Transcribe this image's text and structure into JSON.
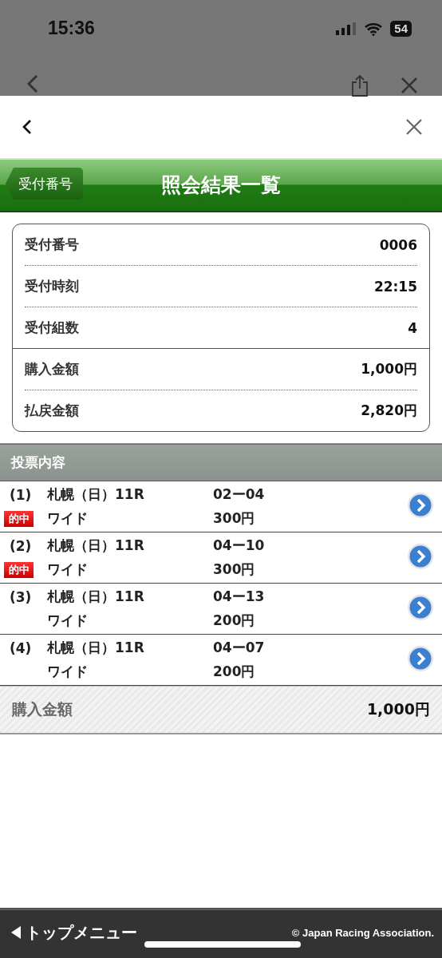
{
  "status_bar": {
    "time": "15:36",
    "battery": "54"
  },
  "header": {
    "back_label": "受付番号",
    "title": "照会結果一覧"
  },
  "summary": {
    "groups": [
      {
        "rows": [
          {
            "label": "受付番号",
            "value": "0006"
          },
          {
            "label": "受付時刻",
            "value": "22:15"
          },
          {
            "label": "受付組数",
            "value": "4"
          }
        ]
      },
      {
        "rows": [
          {
            "label": "購入金額",
            "value": "1,000円"
          },
          {
            "label": "払戻金額",
            "value": "2,820円"
          }
        ]
      }
    ]
  },
  "bets": {
    "section_title": "投票内容",
    "items": [
      {
        "number": "(1)",
        "venue": "札幌（日）11R",
        "hit": true,
        "hit_label": "的中",
        "type": "ワイド",
        "combination": "02ー04",
        "amount": "300円"
      },
      {
        "number": "(2)",
        "venue": "札幌（日）11R",
        "hit": true,
        "hit_label": "的中",
        "type": "ワイド",
        "combination": "04ー10",
        "amount": "300円"
      },
      {
        "number": "(3)",
        "venue": "札幌（日）11R",
        "hit": false,
        "type": "ワイド",
        "combination": "04ー13",
        "amount": "200円"
      },
      {
        "number": "(4)",
        "venue": "札幌（日）11R",
        "hit": false,
        "type": "ワイド",
        "combination": "04ー07",
        "amount": "200円"
      }
    ]
  },
  "total": {
    "label": "購入金額",
    "value": "1,000円"
  },
  "footer": {
    "menu_label": "トップメニュー",
    "copyright": "© Japan Racing Association."
  }
}
